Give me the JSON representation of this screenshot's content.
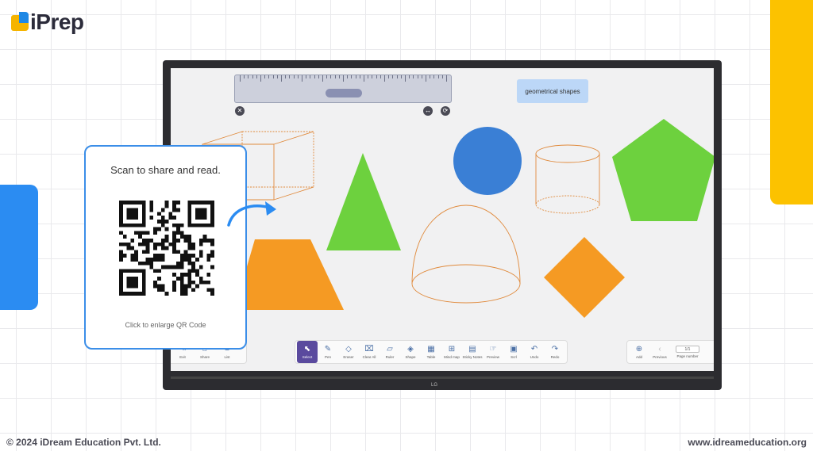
{
  "brand": {
    "name": "iPrep"
  },
  "board": {
    "label": "geometrical shapes",
    "brand_mark": "LG"
  },
  "ruler": {
    "close_icon": "close-icon",
    "move_icon": "move-icon",
    "rotate_icon": "rotate-icon"
  },
  "toolbar_left": [
    {
      "label": "Exit",
      "icon": "exit-icon"
    },
    {
      "label": "Share",
      "icon": "share-icon"
    },
    {
      "label": "List",
      "icon": "list-icon"
    }
  ],
  "toolbar_main": [
    {
      "label": "Select",
      "icon": "select-icon",
      "active": true
    },
    {
      "label": "Pen",
      "icon": "pen-icon"
    },
    {
      "label": "Eraser",
      "icon": "eraser-icon"
    },
    {
      "label": "Clear All",
      "icon": "clear-all-icon"
    },
    {
      "label": "Ruler",
      "icon": "ruler-icon"
    },
    {
      "label": "Shape",
      "icon": "shape-icon"
    },
    {
      "label": "Table",
      "icon": "table-icon"
    },
    {
      "label": "Mind map",
      "icon": "mind-map-icon"
    },
    {
      "label": "Sticky Notes",
      "icon": "sticky-notes-icon"
    },
    {
      "label": "Preview",
      "icon": "preview-icon"
    },
    {
      "label": "Scrl",
      "icon": "scroll-icon"
    },
    {
      "label": "Undo",
      "icon": "undo-icon"
    },
    {
      "label": "Redo",
      "icon": "redo-icon"
    }
  ],
  "toolbar_right": {
    "add_label": "Add",
    "previous_label": "Previous",
    "page_value": "1/1",
    "page_number_label": "Page number"
  },
  "qr_popup": {
    "title": "Scan to share and read.",
    "hint": "Click to enlarge QR Code"
  },
  "colors": {
    "accent_blue": "#2b8cf2",
    "accent_yellow": "#fcc200",
    "shape_green": "#6dd13e",
    "shape_orange": "#f59a23",
    "shape_blue": "#3a7fd5",
    "wire_orange": "#e08a3c"
  },
  "footer": {
    "copyright": "© 2024 iDream Education Pvt. Ltd.",
    "website": "www.idreameducation.org"
  }
}
